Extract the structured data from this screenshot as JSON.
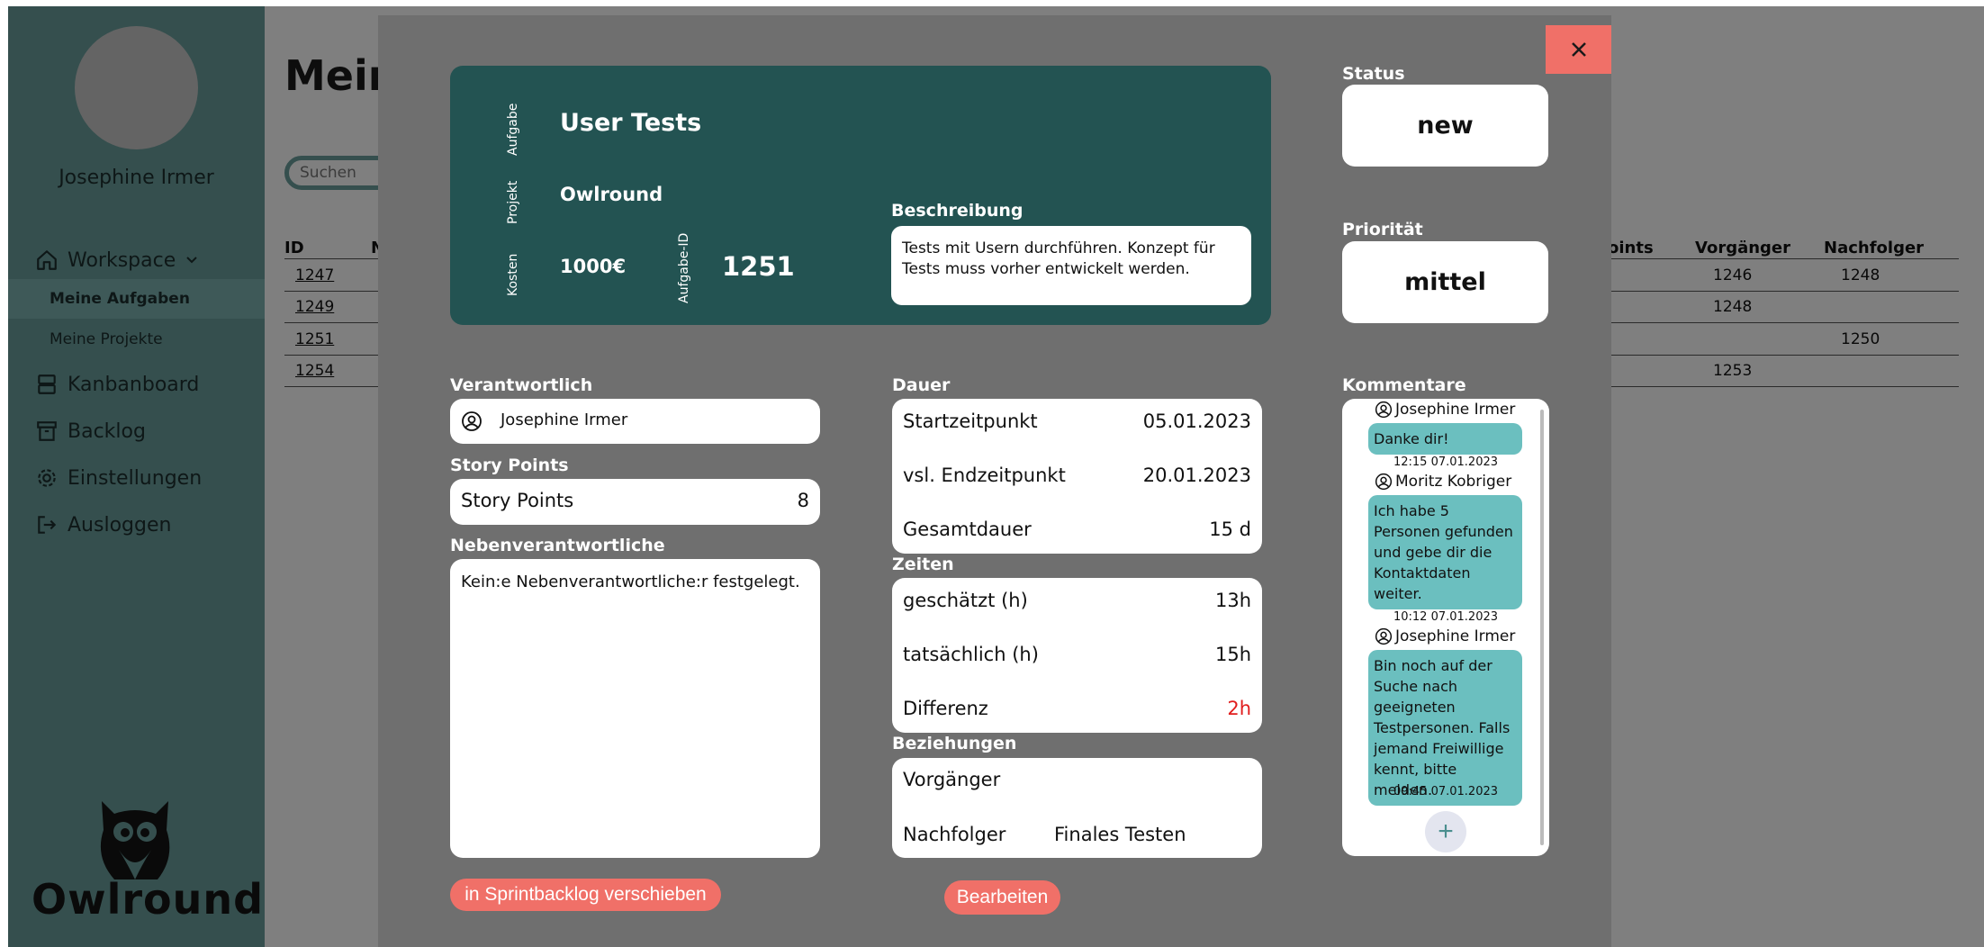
{
  "sidebar": {
    "user_name": "Josephine Irmer",
    "nav": {
      "workspace": "Workspace",
      "my_tasks": "Meine Aufgaben",
      "my_projects": "Meine Projekte",
      "kanban": "Kanbanboard",
      "backlog": "Backlog",
      "settings": "Einstellungen",
      "logout": "Ausloggen"
    },
    "logo_text": "Owlround"
  },
  "main": {
    "title_visible": "Mein",
    "search_placeholder": "Suchen",
    "table": {
      "headers": {
        "id": "ID",
        "name_partial": "N",
        "points_partial": "oints",
        "predecessor": "Vorgänger",
        "successor": "Nachfolger"
      },
      "rows": [
        {
          "id": "1247",
          "predecessor": "1246",
          "successor": "1248"
        },
        {
          "id": "1249",
          "predecessor": "1248",
          "successor": ""
        },
        {
          "id": "1251",
          "predecessor": "",
          "successor": "1250"
        },
        {
          "id": "1254",
          "predecessor": "1253",
          "successor": ""
        }
      ]
    }
  },
  "modal": {
    "close_symbol": "×",
    "header": {
      "labels": {
        "task": "Aufgabe",
        "project": "Projekt",
        "cost": "Kosten",
        "task_id": "Aufgabe-ID"
      },
      "task_name": "User Tests",
      "project_name": "Owlround",
      "cost": "1000€",
      "task_id": "1251",
      "description_label": "Beschreibung",
      "description": "Tests mit Usern durchführen. Konzept für Tests muss vorher entwickelt werden."
    },
    "status": {
      "label": "Status",
      "value": "new"
    },
    "priority": {
      "label": "Priorität",
      "value": "mittel"
    },
    "responsible": {
      "label": "Verantwortlich",
      "name": "Josephine Irmer"
    },
    "story_points": {
      "label": "Story Points",
      "field_label": "Story Points",
      "value": "8"
    },
    "co_responsible": {
      "label": "Nebenverantwortliche",
      "text": "Kein:e Nebenverantwortliche:r festgelegt."
    },
    "duration": {
      "label": "Dauer",
      "start_label": "Startzeitpunkt",
      "start": "05.01.2023",
      "end_label": "vsl. Endzeitpunkt",
      "end": "20.01.2023",
      "total_label": "Gesamtdauer",
      "total": "15 d"
    },
    "times": {
      "label": "Zeiten",
      "estimated_label": "geschätzt (h)",
      "estimated": "13h",
      "actual_label": "tatsächlich (h)",
      "actual": "15h",
      "diff_label": "Differenz",
      "diff": "2h",
      "diff_color": "#e11d1d"
    },
    "relations": {
      "label": "Beziehungen",
      "predecessor_label": "Vorgänger",
      "predecessor": "",
      "successor_label": "Nachfolger",
      "successor": "Finales Testen"
    },
    "comments": {
      "label": "Kommentare",
      "items": [
        {
          "author": "Josephine Irmer",
          "text": "Danke dir!",
          "time": "12:15 07.01.2023"
        },
        {
          "author": "Moritz Kobriger",
          "text": "Ich habe 5 Personen gefunden und gebe dir die Kontaktdaten weiter.",
          "time": "10:12 07.01.2023"
        },
        {
          "author": "Josephine Irmer",
          "text": "Bin noch auf der Suche nach geeigneten Testpersonen. Falls jemand Freiwillige kennt, bitte melden.",
          "time": "09:45 07.01.2023"
        }
      ],
      "add_symbol": "+"
    },
    "buttons": {
      "move_to_sprint": "in Sprintbacklog verschieben",
      "edit": "Bearbeiten"
    }
  },
  "colors": {
    "sidebar": "#6b9f9c",
    "header_card": "#235352",
    "accent_red": "#f07068",
    "bubble": "#6bbfbf"
  }
}
